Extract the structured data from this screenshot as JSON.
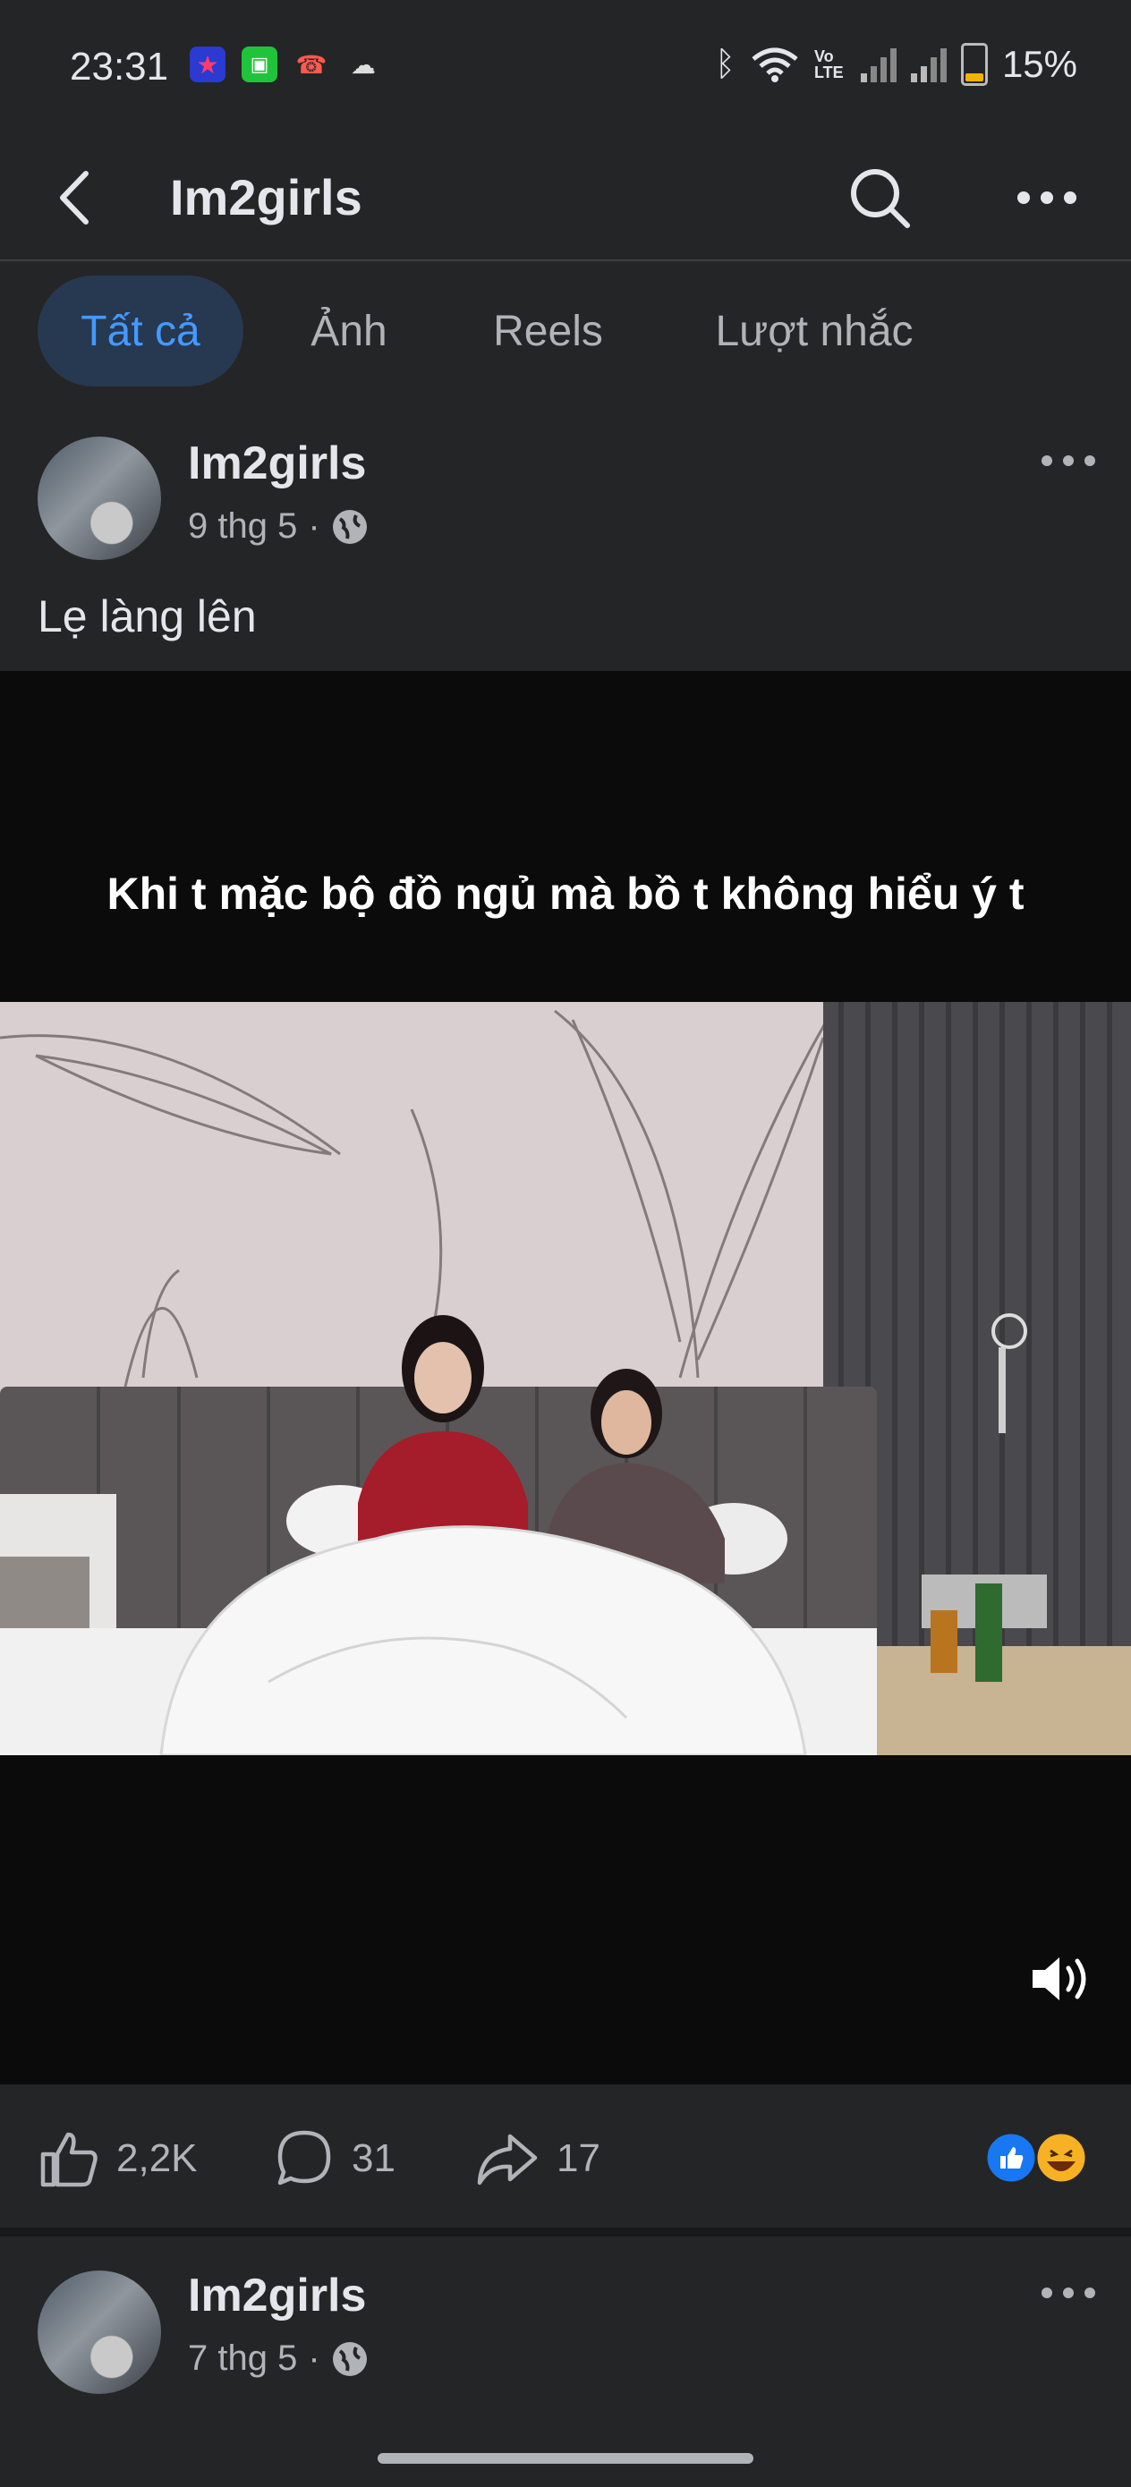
{
  "status_bar": {
    "time": "23:31",
    "battery": "15%",
    "lte_label": "Vo LTE",
    "icons": [
      "app-star-icon",
      "app-green-icon",
      "missed-call-icon",
      "cloud-icon",
      "bluetooth-icon",
      "wifi-icon",
      "signal-icon",
      "battery-icon"
    ]
  },
  "header": {
    "title": "Im2girls",
    "icons": [
      "back-icon",
      "search-icon",
      "more-icon"
    ]
  },
  "tabs": [
    {
      "label": "Tất cả",
      "active": true
    },
    {
      "label": "Ảnh",
      "active": false
    },
    {
      "label": "Reels",
      "active": false
    },
    {
      "label": "Lượt nhắc",
      "active": false
    }
  ],
  "post1": {
    "author": "Im2girls",
    "date": "9 thg 5",
    "separator": "·",
    "caption": "Lẹ làng lên",
    "video_caption": "Khi t mặc bộ đồ ngủ mà bồ t không hiểu ý t",
    "likes": "2,2K",
    "comments": "31",
    "shares": "17",
    "reactions": [
      "like-reaction-icon",
      "haha-reaction-icon"
    ]
  },
  "post2": {
    "author": "Im2girls",
    "date": "7 thg 5",
    "separator": "·"
  },
  "colors": {
    "background": "#242526",
    "active_tab_bg": "#263951",
    "accent": "#4599ff"
  }
}
